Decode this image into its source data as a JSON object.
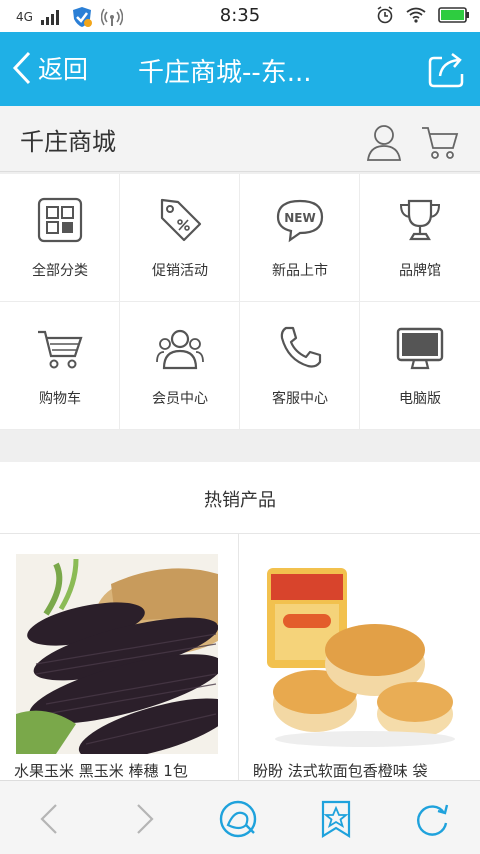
{
  "status_bar": {
    "network": "4G",
    "time": "8:35"
  },
  "app_bar": {
    "back_label": "返回",
    "title": "千庄商城--东..."
  },
  "store_bar": {
    "name": "千庄商城"
  },
  "menu": [
    {
      "label": "全部分类",
      "icon": "category-grid-icon"
    },
    {
      "label": "促销活动",
      "icon": "sale-tag-icon"
    },
    {
      "label": "新品上市",
      "icon": "new-badge-icon"
    },
    {
      "label": "品牌馆",
      "icon": "trophy-icon"
    },
    {
      "label": "购物车",
      "icon": "cart-icon"
    },
    {
      "label": "会员中心",
      "icon": "members-icon"
    },
    {
      "label": "客服中心",
      "icon": "phone-icon"
    },
    {
      "label": "电脑版",
      "icon": "monitor-icon"
    }
  ],
  "hot_section": {
    "title": "热销产品"
  },
  "products": [
    {
      "name": "水果玉米 黑玉米 棒穗 1包"
    },
    {
      "name": "盼盼 法式软面包香橙味 袋"
    }
  ],
  "colors": {
    "accent": "#1fb0e6",
    "icon_stroke": "#555555"
  }
}
